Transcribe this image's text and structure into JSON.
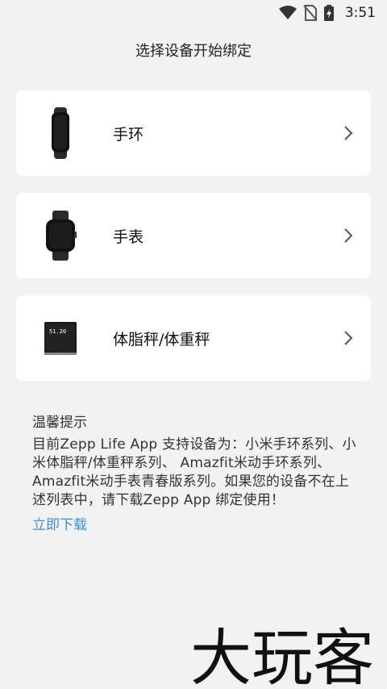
{
  "status_bar": {
    "time": "3:51"
  },
  "header": {
    "title": "选择设备开始绑定"
  },
  "devices": [
    {
      "label": "手环",
      "icon": "band-icon"
    },
    {
      "label": "手表",
      "icon": "watch-icon"
    },
    {
      "label": "体脂秤/体重秤",
      "icon": "scale-icon",
      "scale_reading": "51.20"
    }
  ],
  "tips": {
    "title": "温馨提示",
    "body": "目前Zepp Life App 支持设备为：小米手环系列、小米体脂秤/体重秤系列、 Amazfit米动手环系列、Amazfit米动手表青春版系列。如果您的设备不在上述列表中，请下载Zepp App 绑定使用！",
    "download_link": "立即下载"
  },
  "watermark": {
    "text": "大玩客"
  },
  "colors": {
    "background": "#f2f2f2",
    "card": "#ffffff",
    "link": "#3c8fd8"
  }
}
